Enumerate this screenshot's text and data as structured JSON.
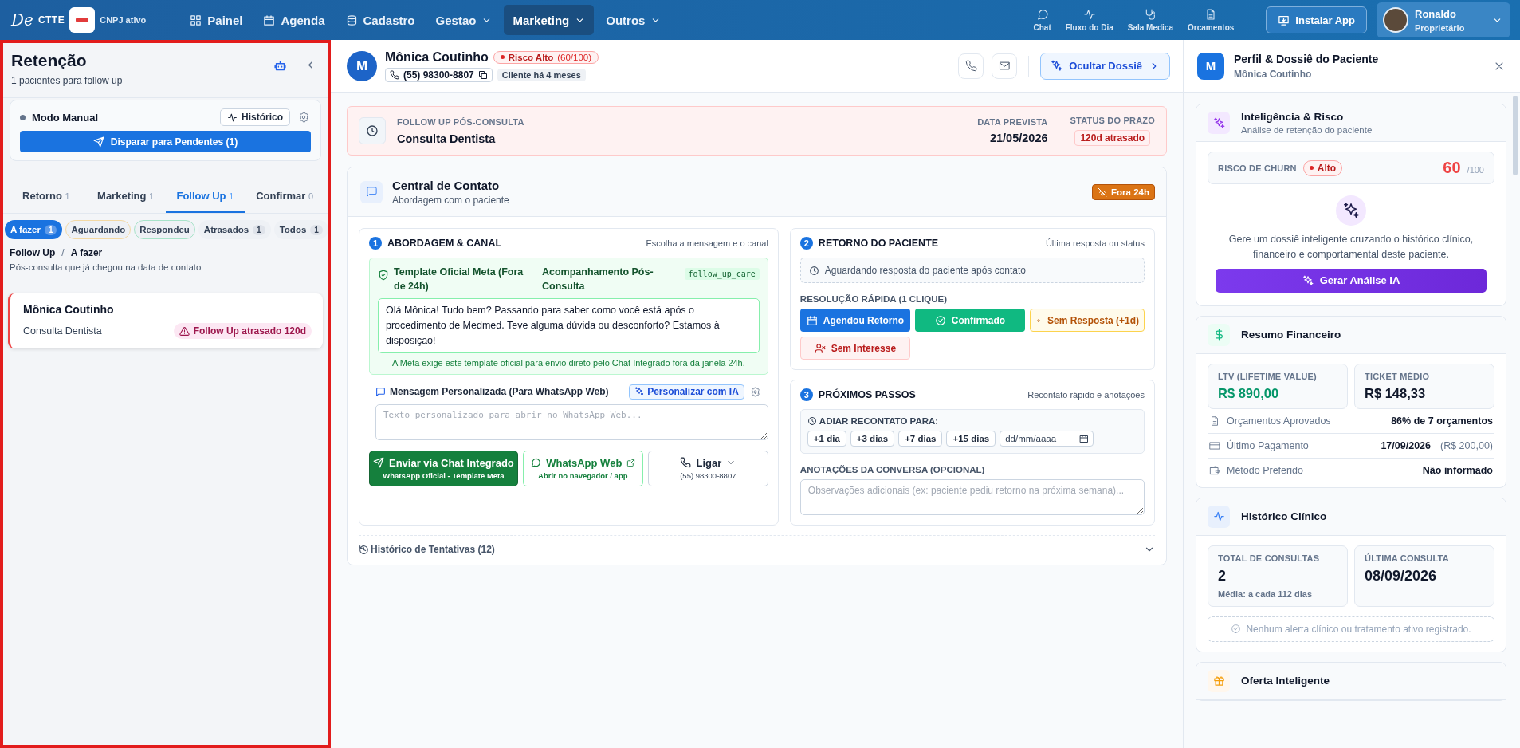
{
  "topbar": {
    "logo": {
      "mark": "De",
      "name": "CTTE"
    },
    "clinic_status": "CNPJ ativo",
    "nav": [
      {
        "label": "Painel",
        "kind": "link",
        "selected": false
      },
      {
        "label": "Agenda",
        "kind": "link",
        "selected": false
      },
      {
        "label": "Cadastro",
        "kind": "link",
        "selected": false
      },
      {
        "label": "Gestao",
        "kind": "menu",
        "selected": false
      },
      {
        "label": "Marketing",
        "kind": "menu",
        "selected": true
      },
      {
        "label": "Outros",
        "kind": "menu",
        "selected": false
      }
    ],
    "shortcuts": [
      "Chat",
      "Fluxo do Dia",
      "Sala Medica",
      "Orcamentos"
    ],
    "install": "Instalar App",
    "user": {
      "name": "Ronaldo",
      "role": "Proprietário"
    }
  },
  "left": {
    "title": "Retenção",
    "subtitle": "1 pacientes para follow up",
    "mode": {
      "label": "Modo Manual",
      "history": "Histórico",
      "dispatch": "Disparar para Pendentes (1)"
    },
    "tabs": [
      {
        "label": "Retorno",
        "count": "1",
        "selected": false
      },
      {
        "label": "Marketing",
        "count": "1",
        "selected": false
      },
      {
        "label": "Follow Up",
        "count": "1",
        "selected": true
      },
      {
        "label": "Confirmar",
        "count": "0",
        "selected": false
      }
    ],
    "filters": [
      {
        "label": "A fazer",
        "count": "1",
        "selected": true
      },
      {
        "label": "Aguardando",
        "selected": false,
        "color": "#f3d9a4"
      },
      {
        "label": "Respondeu",
        "selected": false,
        "color": "#a7e3c9"
      },
      {
        "label": "Atrasados",
        "count": "1",
        "selected": false
      },
      {
        "label": "Todos",
        "count": "1",
        "selected": false
      }
    ],
    "breadcrumb": {
      "items": [
        "Follow Up",
        "A fazer"
      ],
      "separator": "/"
    },
    "description": "Pós-consulta que já chegou na data de contato",
    "patients": [
      {
        "name": "Mônica Coutinho",
        "procedure": "Consulta Dentista",
        "status": "Follow Up atrasado 120d"
      }
    ]
  },
  "patient": {
    "initial": "M",
    "name": "Mônica Coutinho",
    "risk": "Risco Alto",
    "risk_score": "(60/100)",
    "phone": "(55) 98300-8807",
    "since": "Cliente há 4 meses",
    "toggle": "Ocultar Dossiê"
  },
  "followup": {
    "type": "FOLLOW UP PÓS-CONSULTA",
    "title": "Consulta Dentista",
    "date_label": "DATA PREVISTA",
    "date": "21/05/2026",
    "status_label": "STATUS DO PRAZO",
    "status": "120d atrasado"
  },
  "contact": {
    "title": "Central de Contato",
    "subtitle": "Abordagem com o paciente",
    "window_badge": "Fora 24h",
    "approach": {
      "number": "1",
      "title": "ABORDAGEM & CANAL",
      "hint": "Escolha a mensagem e o canal",
      "template": {
        "name": "Template Oficial Meta (Fora de 24h)",
        "purpose": "Acompanhamento Pós-Consulta",
        "code": "follow_up_care",
        "message": "Olá Mônica! Tudo bem? Passando para saber como você está após o procedimento de Medmed. Teve alguma dúvida ou desconforto? Estamos à disposição!",
        "note": "A Meta exige este template oficial para envio direto pelo Chat Integrado fora da janela 24h."
      },
      "custom_label": "Mensagem Personalizada (Para WhatsApp Web)",
      "ai_button": "Personalizar com IA",
      "custom_placeholder": "Texto personalizado para abrir no WhatsApp Web...",
      "channels": [
        {
          "kind": "chat",
          "label": "Enviar via Chat Integrado",
          "sub": "WhatsApp Oficial - Template Meta"
        },
        {
          "kind": "web",
          "label": "WhatsApp Web",
          "sub": "Abrir no navegador / app"
        },
        {
          "kind": "call",
          "label": "Ligar",
          "sub": "(55) 98300-8807"
        }
      ]
    },
    "response": {
      "number": "2",
      "title": "RETORNO DO PACIENTE",
      "hint": "Última resposta ou status",
      "status": "Aguardando resposta do paciente após contato",
      "quick_label": "RESOLUÇÃO RÁPIDA (1 CLIQUE)",
      "actions": [
        {
          "kind": "primary",
          "label": "Agendou Retorno"
        },
        {
          "kind": "success",
          "label": "Confirmado"
        },
        {
          "kind": "warning",
          "label": "Sem Resposta (+1d)"
        },
        {
          "kind": "danger",
          "label": "Sem Interesse"
        }
      ]
    },
    "next": {
      "number": "3",
      "title": "PRÓXIMOS PASSOS",
      "hint": "Recontato rápido e anotações",
      "postpone_label": "ADIAR RECONTATO PARA:",
      "options": [
        "+1 dia",
        "+3 dias",
        "+7 dias",
        "+15 dias"
      ],
      "date_placeholder": "dd/mm/aaaa",
      "notes_label": "ANOTAÇÕES DA CONVERSA (OPCIONAL)",
      "notes_placeholder": "Observações adicionais (ex: paciente pediu retorno na próxima semana)..."
    },
    "attempts": "Histórico de Tentativas (12)"
  },
  "dossier": {
    "title": "Perfil & Dossiê do Paciente",
    "initial": "M",
    "name": "Mônica Coutinho",
    "intel": {
      "title": "Inteligência & Risco",
      "subtitle": "Análise de retenção do paciente",
      "churn_label": "RISCO DE CHURN",
      "churn_level": "Alto",
      "score": "60",
      "score_max": "/100",
      "prompt": "Gere um dossiê inteligente cruzando o histórico clínico, financeiro e comportamental deste paciente.",
      "button": "Gerar Análise IA"
    },
    "finance": {
      "title": "Resumo Financeiro",
      "stats": [
        {
          "label": "LTV (LIFETIME VALUE)",
          "value": "R$ 890,00",
          "kind": "positive"
        },
        {
          "label": "TICKET MÉDIO",
          "value": "R$ 148,33",
          "kind": "plain"
        }
      ],
      "rows": [
        {
          "label": "Orçamentos Aprovados",
          "value": "86% de 7 orçamentos"
        },
        {
          "label": "Último Pagamento",
          "value": "17/09/2026",
          "extra": "(R$ 200,00)"
        },
        {
          "label": "Método Preferido",
          "value": "Não informado"
        }
      ]
    },
    "clinical": {
      "title": "Histórico Clínico",
      "stats": [
        {
          "label": "TOTAL DE CONSULTAS",
          "value": "2",
          "note": "Média: a cada 112 dias"
        },
        {
          "label": "ÚLTIMA CONSULTA",
          "value": "08/09/2026"
        }
      ],
      "alert": "Nenhum alerta clínico ou tratamento ativo registrado."
    },
    "offer": {
      "title": "Oferta Inteligente"
    }
  }
}
